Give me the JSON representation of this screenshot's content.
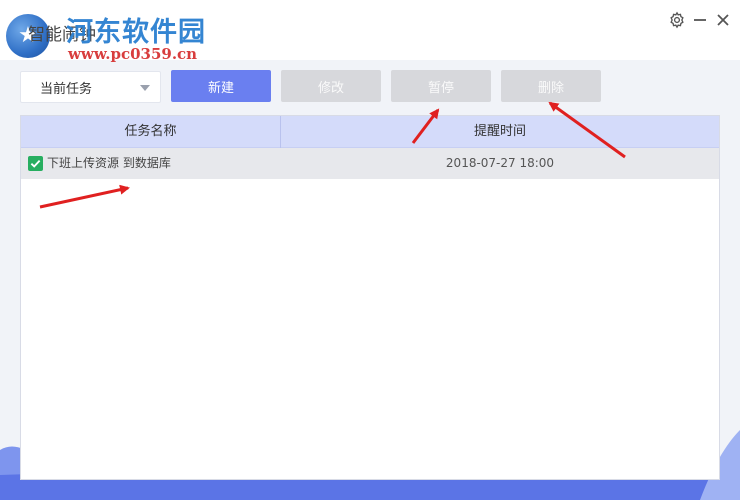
{
  "window": {
    "title": "智能闹钟",
    "watermark": "河东软件园",
    "watermark_url": "www.pc0359.cn"
  },
  "toolbar": {
    "task_filter": {
      "selected": "当前任务"
    },
    "new_label": "新建",
    "edit_label": "修改",
    "pause_label": "暂停",
    "delete_label": "删除"
  },
  "table": {
    "columns": [
      "任务名称",
      "提醒时间"
    ],
    "rows": [
      {
        "name": "下班上传资源 到数据库",
        "time": "2018-07-27 18:00",
        "checked": true
      }
    ]
  },
  "colors": {
    "primary_button": "#6a7ff0",
    "header_bg": "#d4dbfa",
    "checkbox": "#27ae60",
    "arrow": "#e02020",
    "wave": "#5b74e6"
  },
  "icons": {
    "settings": "gear-icon",
    "minimize": "minimize-icon",
    "close": "close-icon",
    "dropdown": "chevron-down-icon",
    "check": "checkmark-icon"
  }
}
